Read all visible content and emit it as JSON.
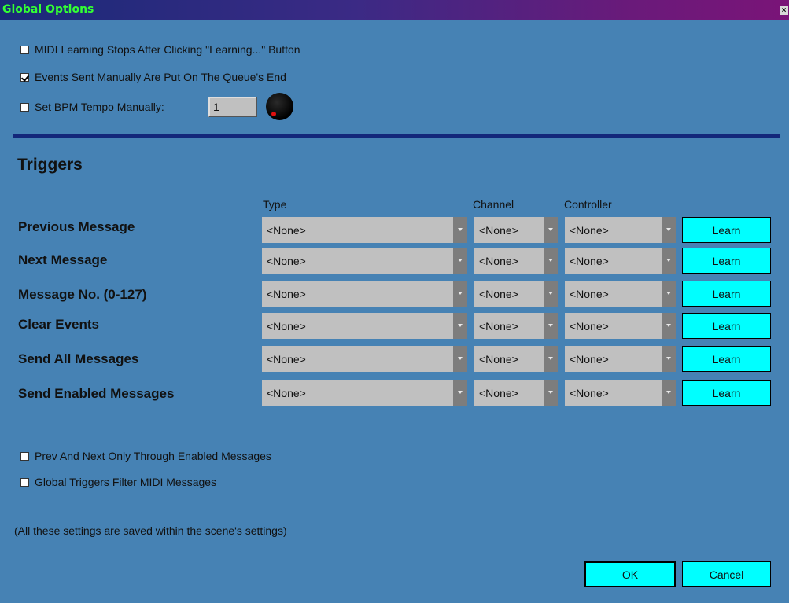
{
  "window": {
    "title": "Global Options",
    "close_label": "×"
  },
  "options": {
    "midi_learning": {
      "label": "MIDI Learning Stops After Clicking \"Learning...\" Button",
      "checked": false
    },
    "events_queue_end": {
      "label": "Events Sent Manually Are Put On The Queue's End",
      "checked": true
    },
    "set_bpm": {
      "label": "Set BPM Tempo Manually:",
      "checked": false,
      "value": "1"
    }
  },
  "triggers": {
    "heading": "Triggers",
    "columns": {
      "type": "Type",
      "channel": "Channel",
      "controller": "Controller"
    },
    "learn_label": "Learn",
    "rows": [
      {
        "label": "Previous Message",
        "type": "<None>",
        "channel": "<None>",
        "controller": "<None>"
      },
      {
        "label": "Next Message",
        "type": "<None>",
        "channel": "<None>",
        "controller": "<None>"
      },
      {
        "label": "Message No. (0-127)",
        "type": "<None>",
        "channel": "<None>",
        "controller": "<None>"
      },
      {
        "label": "Clear Events",
        "type": "<None>",
        "channel": "<None>",
        "controller": "<None>"
      },
      {
        "label": "Send All Messages",
        "type": "<None>",
        "channel": "<None>",
        "controller": "<None>"
      },
      {
        "label": "Send Enabled Messages",
        "type": "<None>",
        "channel": "<None>",
        "controller": "<None>"
      }
    ]
  },
  "bottom_options": {
    "prev_next_enabled": {
      "label": "Prev And Next Only Through Enabled Messages",
      "checked": false
    },
    "global_filter": {
      "label": "Global Triggers Filter MIDI Messages",
      "checked": false
    }
  },
  "note": "(All these settings are saved within the scene's settings)",
  "buttons": {
    "ok": "OK",
    "cancel": "Cancel"
  },
  "colors": {
    "background": "#4682b4",
    "accent": "#00ffff",
    "title_text": "#33ff33",
    "divider": "#13277a"
  }
}
